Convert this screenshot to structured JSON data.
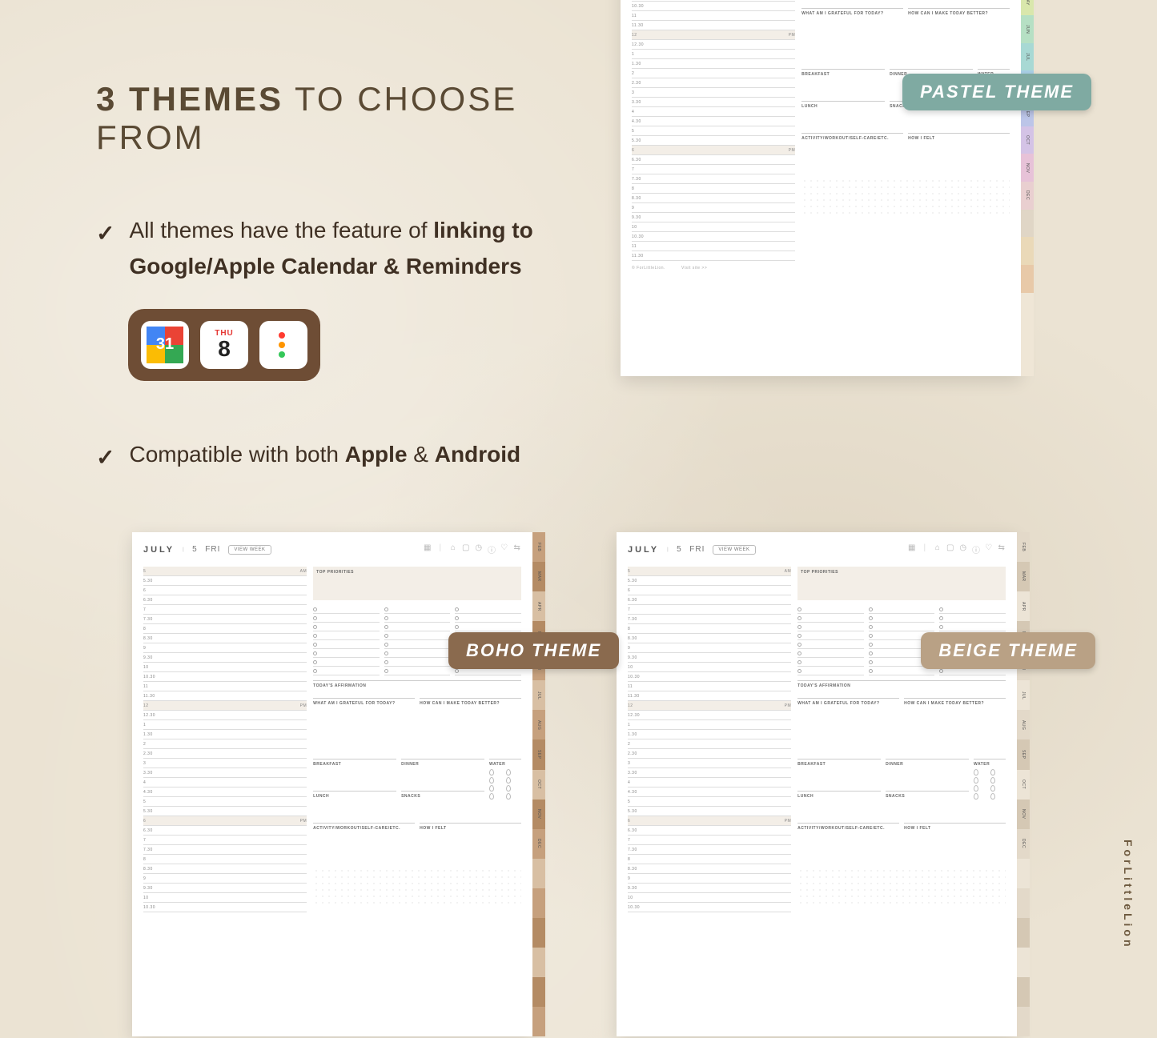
{
  "headline": {
    "bold": "3 THEMES",
    "rest": " TO CHOOSE FROM"
  },
  "bullets": [
    {
      "pre": "All themes have the feature of ",
      "bold": "linking to Google/Apple Calendar & Reminders"
    },
    {
      "pre": "Compatible with both ",
      "bold1": "Apple",
      "mid": " & ",
      "bold2": "Android"
    }
  ],
  "icon_tray": {
    "gcal_day": "31",
    "apple_dow": "THU",
    "apple_day": "8"
  },
  "theme_badges": {
    "pastel": "PASTEL THEME",
    "boho": "BOHO THEME",
    "beige": "BEIGE THEME"
  },
  "planner": {
    "month": "JULY",
    "date": "5",
    "dow": "FRI",
    "view_week": "VIEW WEEK",
    "sections": {
      "top_priorities": "TOP PRIORITIES",
      "affirmation": "TODAY'S AFFIRMATION",
      "grateful": "WHAT AM I GRATEFUL FOR TODAY?",
      "better": "HOW CAN I MAKE TODAY BETTER?",
      "breakfast": "BREAKFAST",
      "dinner": "DINNER",
      "lunch": "LUNCH",
      "snacks": "SNACKS",
      "water": "WATER",
      "activity": "ACTIVITY/WORKOUT/SELF-CARE/ETC.",
      "felt": "HOW I FELT"
    },
    "am": "AM",
    "pm": "PM",
    "schedule_pastel": [
      "6",
      "6.30",
      "7",
      "7.30",
      "8",
      "8.30",
      "9",
      "9.30",
      "10",
      "10.30",
      "11",
      "11.30",
      "12",
      "12.30",
      "1",
      "1.30",
      "2",
      "2.30",
      "3",
      "3.30",
      "4",
      "4.30",
      "5",
      "5.30",
      "6",
      "6.30",
      "7",
      "7.30",
      "8",
      "8.30",
      "9",
      "9.30",
      "10",
      "10.30",
      "11",
      "11.30"
    ],
    "schedule_full": [
      "5",
      "5.30",
      "6",
      "6.30",
      "7",
      "7.30",
      "8",
      "8.30",
      "9",
      "9.30",
      "10",
      "10.30",
      "11",
      "11.30",
      "12",
      "12.30",
      "1",
      "1.30",
      "2",
      "2.30",
      "3",
      "3.30",
      "4",
      "4.30",
      "5",
      "5.30",
      "6",
      "6.30",
      "7",
      "7.30",
      "8",
      "8.30",
      "9",
      "9.30",
      "10",
      "10.30"
    ],
    "tabs": [
      "FEB",
      "MAR",
      "APR",
      "MAY",
      "JUN",
      "JUL",
      "AUG",
      "SEP",
      "OCT",
      "NOV",
      "DEC",
      "",
      "",
      "",
      "",
      "",
      ""
    ],
    "footer_credit": "© ForLittleLion.",
    "footer_link": "Visit site >>"
  },
  "watermark": "ForLittleLion"
}
